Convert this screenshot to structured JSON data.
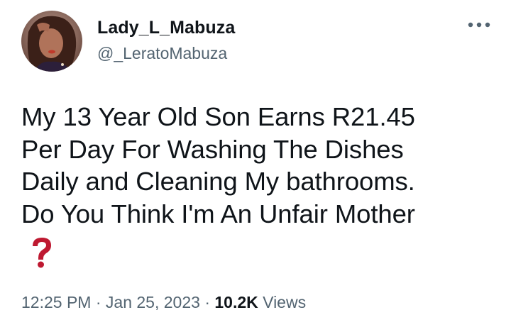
{
  "tweet": {
    "author": {
      "display_name": "Lady_L_Mabuza",
      "handle": "@_LeratoMabuza",
      "avatar_icon": "profile-photo"
    },
    "more_icon": "more-horizontal-icon",
    "text": "My 13 Year Old Son Earns R21.45\nPer Day For Washing The Dishes\nDaily and Cleaning My bathrooms.\nDo You Think I'm An Unfair Mother",
    "emoji": "red-question-mark",
    "emoji_color": "#be1931",
    "time": "12:25 PM",
    "separator": "·",
    "date": "Jan 25, 2023",
    "views_count": "10.2K",
    "views_label": "Views"
  },
  "colors": {
    "text_primary": "#0f1419",
    "text_secondary": "#536471",
    "background": "#ffffff"
  }
}
